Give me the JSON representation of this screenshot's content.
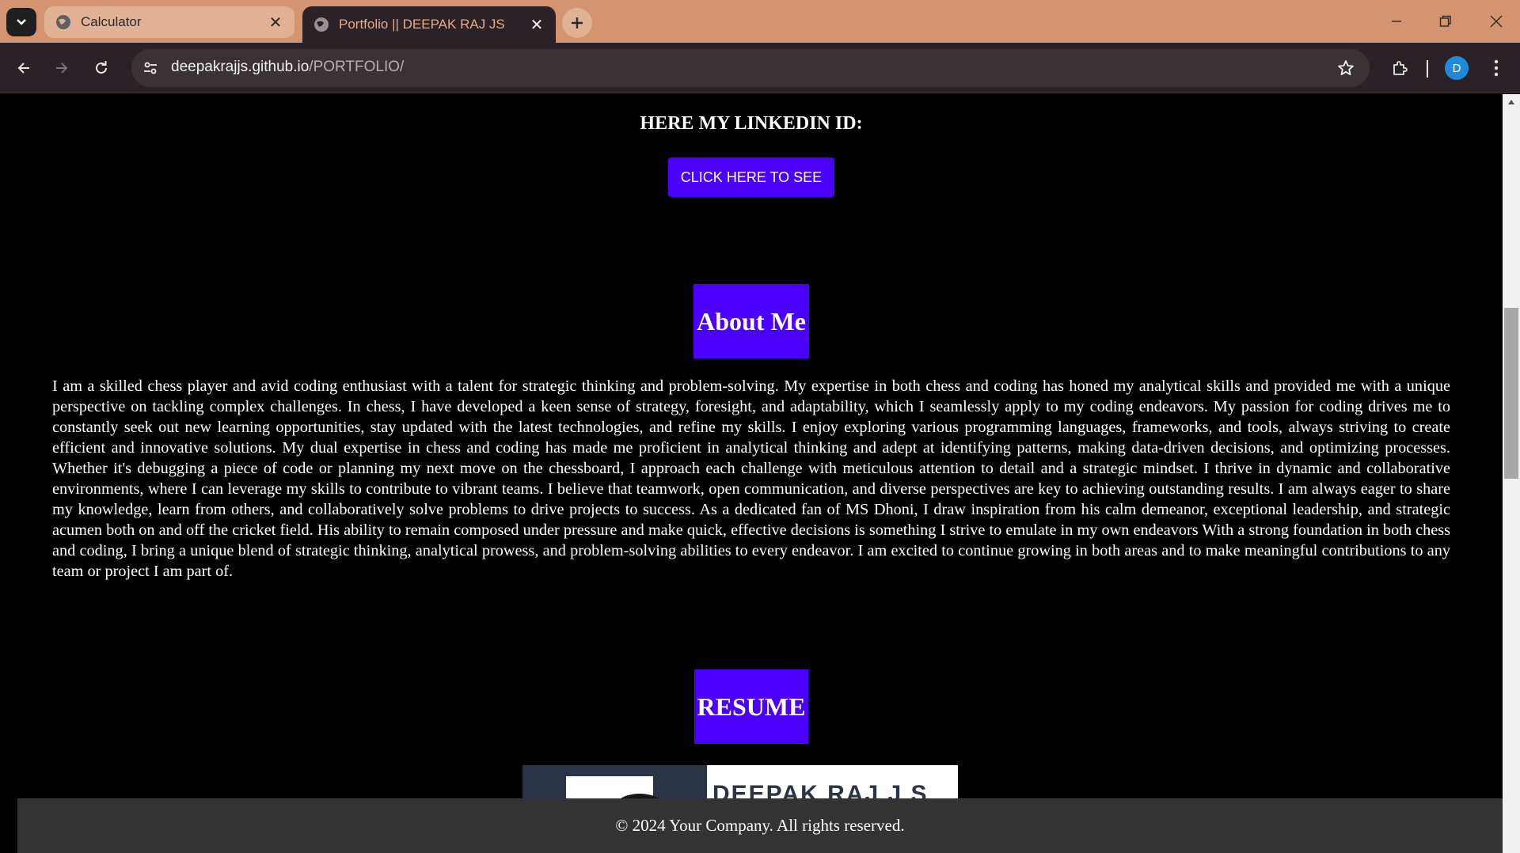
{
  "browser": {
    "tabs": [
      {
        "title": "Calculator",
        "active": false
      },
      {
        "title": "Portfolio || DEEPAK RAJ JS",
        "active": true
      }
    ],
    "address": {
      "domain": "deepakrajjs.github.io",
      "path": "/PORTFOLIO/"
    },
    "profile_initial": "D",
    "colors": {
      "frame": "#d4946f",
      "toolbar": "#2a2227",
      "accent_tab_text": "#e8a98a"
    }
  },
  "page": {
    "linkedin_heading": "HERE MY LINKEDIN ID:",
    "linkedin_button": "CLICK HERE TO SEE",
    "about_title": "About Me",
    "about_text": "I am a skilled chess player and avid coding enthusiast with a talent for strategic thinking and problem-solving. My expertise in both chess and coding has honed my analytical skills and provided me with a unique perspective on tackling complex challenges. In chess, I have developed a keen sense of strategy, foresight, and adaptability, which I seamlessly apply to my coding endeavors. My passion for coding drives me to constantly seek out new learning opportunities, stay updated with the latest technologies, and refine my skills. I enjoy exploring various programming languages, frameworks, and tools, always striving to create efficient and innovative solutions. My dual expertise in chess and coding has made me proficient in analytical thinking and adept at identifying patterns, making data-driven decisions, and optimizing processes. Whether it's debugging a piece of code or planning my next move on the chessboard, I approach each challenge with meticulous attention to detail and a strategic mindset. I thrive in dynamic and collaborative environments, where I can leverage my skills to contribute to vibrant teams. I believe that teamwork, open communication, and diverse perspectives are key to achieving outstanding results. I am always eager to share my knowledge, learn from others, and collaboratively solve problems to drive projects to success. As a dedicated fan of MS Dhoni, I draw inspiration from his calm demeanor, exceptional leadership, and strategic acumen both on and off the cricket field. His ability to remain composed under pressure and make quick, effective decisions is something I strive to emulate in my own endeavors With a strong foundation in both chess and coding, I bring a unique blend of strategic thinking, analytical prowess, and problem-solving abilities to every endeavor. I am excited to continue growing in both areas and to make meaningful contributions to any team or project I am part of.",
    "resume_title": "RESUME",
    "resume_name": "DEEPAK RAJ J S",
    "footer": "© 2024 Your Company. All rights reserved.",
    "colors": {
      "accent": "#4b00ff",
      "background": "#000000",
      "footer": "#333333"
    }
  }
}
